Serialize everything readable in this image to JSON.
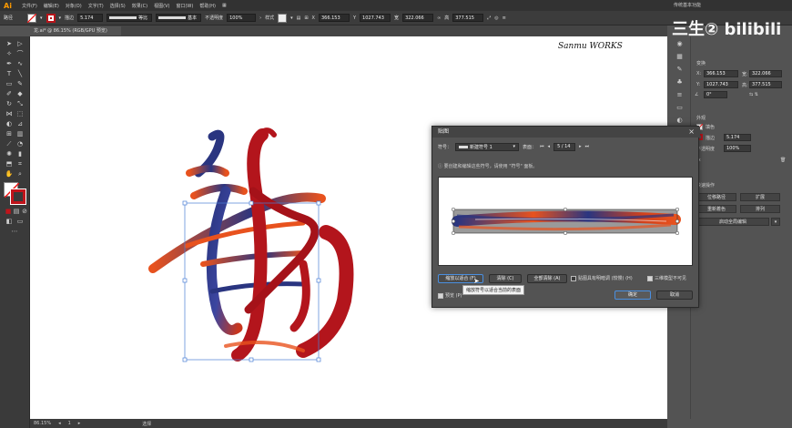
{
  "app": {
    "logo": "Ai",
    "menu": [
      "文件(F)",
      "编辑(E)",
      "对象(O)",
      "文字(T)",
      "选择(S)",
      "效果(C)",
      "视图(V)",
      "窗口(W)",
      "帮助(H)"
    ],
    "bridge_icon": "▦",
    "workspace": "传统基本功能"
  },
  "watermark": "⁠三生② bilibili",
  "control_bar": {
    "selection_label": "路径",
    "stroke_label": "描边",
    "stroke_value": "5.174",
    "profile_label": "等比",
    "brush_label": "基本",
    "opacity_label": "不透明度",
    "opacity_value": "100%",
    "style_label": "样式",
    "x_label": "X",
    "x_value": "366.153",
    "y_label": "Y",
    "y_value": "1027.743",
    "w_label": "宽",
    "w_value": "322.066",
    "h_label": "高",
    "h_value": "377.515"
  },
  "doc_tab": "龙.ai* @ 86.15% (RGB/GPU 预览)",
  "canvas": {
    "signature": "Sanmu WORKS",
    "stroke_colors": {
      "blue": "#2a3580",
      "red": "#b3151c",
      "orange": "#e8521e"
    }
  },
  "status_bar": {
    "zoom": "86.15%",
    "page": "1",
    "tool": "选择"
  },
  "properties": {
    "section_transform": "变换",
    "x_label": "X:",
    "x_value": "366.153",
    "y_label": "Y:",
    "y_value": "1027.743",
    "w_label": "宽:",
    "w_value": "322.066",
    "h_label": "高:",
    "h_value": "377.515",
    "angle_value": "0°",
    "section_appearance": "外观",
    "fill_label": "填色",
    "stroke_label": "描边",
    "stroke_value": "5.174",
    "opacity_label": "不透明度",
    "opacity_value": "100%",
    "fx_label": "fx",
    "quick_actions": "快速操作",
    "btn_offset": "位移路径",
    "btn_expand": "扩展",
    "btn_recolor": "重新着色",
    "btn_arrange": "排列",
    "btn_start_edit": "启动全局编辑"
  },
  "dialog": {
    "title": "贴图",
    "symbol_label": "符号：",
    "symbol_value": "新建符号 1",
    "surface_label": "表面：",
    "surface_value": "5 / 14",
    "info_text": "要创建和编辑这些符号，请使用 \"符号\" 面板。",
    "btn_scale_fit": "缩放以适合 (F)",
    "btn_clear": "清除 (C)",
    "btn_clear_all": "全部清除 (A)",
    "check_shade": "贴图具有明暗调 (较慢) (H)",
    "check_invisible": "三维模型不可见",
    "check_preview": "预览 (P)",
    "btn_ok": "确定",
    "btn_cancel": "取消",
    "tooltip": "缩放符号以适合当前的表面"
  }
}
